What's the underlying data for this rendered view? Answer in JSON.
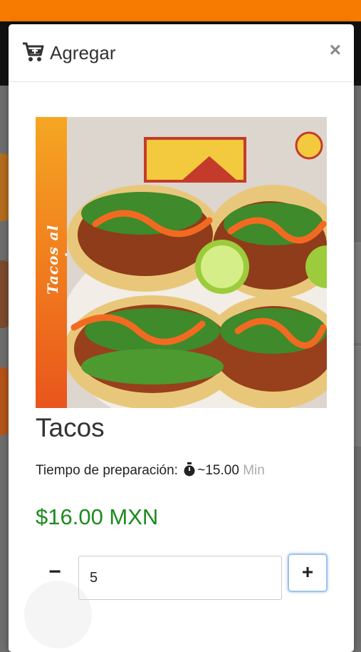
{
  "modal": {
    "title": "Agregar",
    "close_label": "×",
    "cart_icon": "cart-plus-icon"
  },
  "image": {
    "banner_text": "Tacos al pastor"
  },
  "product": {
    "name": "Tacos",
    "prep_label": "Tiempo de preparación:",
    "prep_time": "~15.00",
    "prep_unit": "Min",
    "timer_icon": "stopwatch-icon",
    "price": "$16.00 MXN"
  },
  "quantity": {
    "decrement_label": "−",
    "value": "5",
    "increment_label": "+"
  },
  "colors": {
    "header_bar": "#f77b00",
    "price": "#1e8a1e",
    "focus_ring": "#9fc3ea"
  }
}
